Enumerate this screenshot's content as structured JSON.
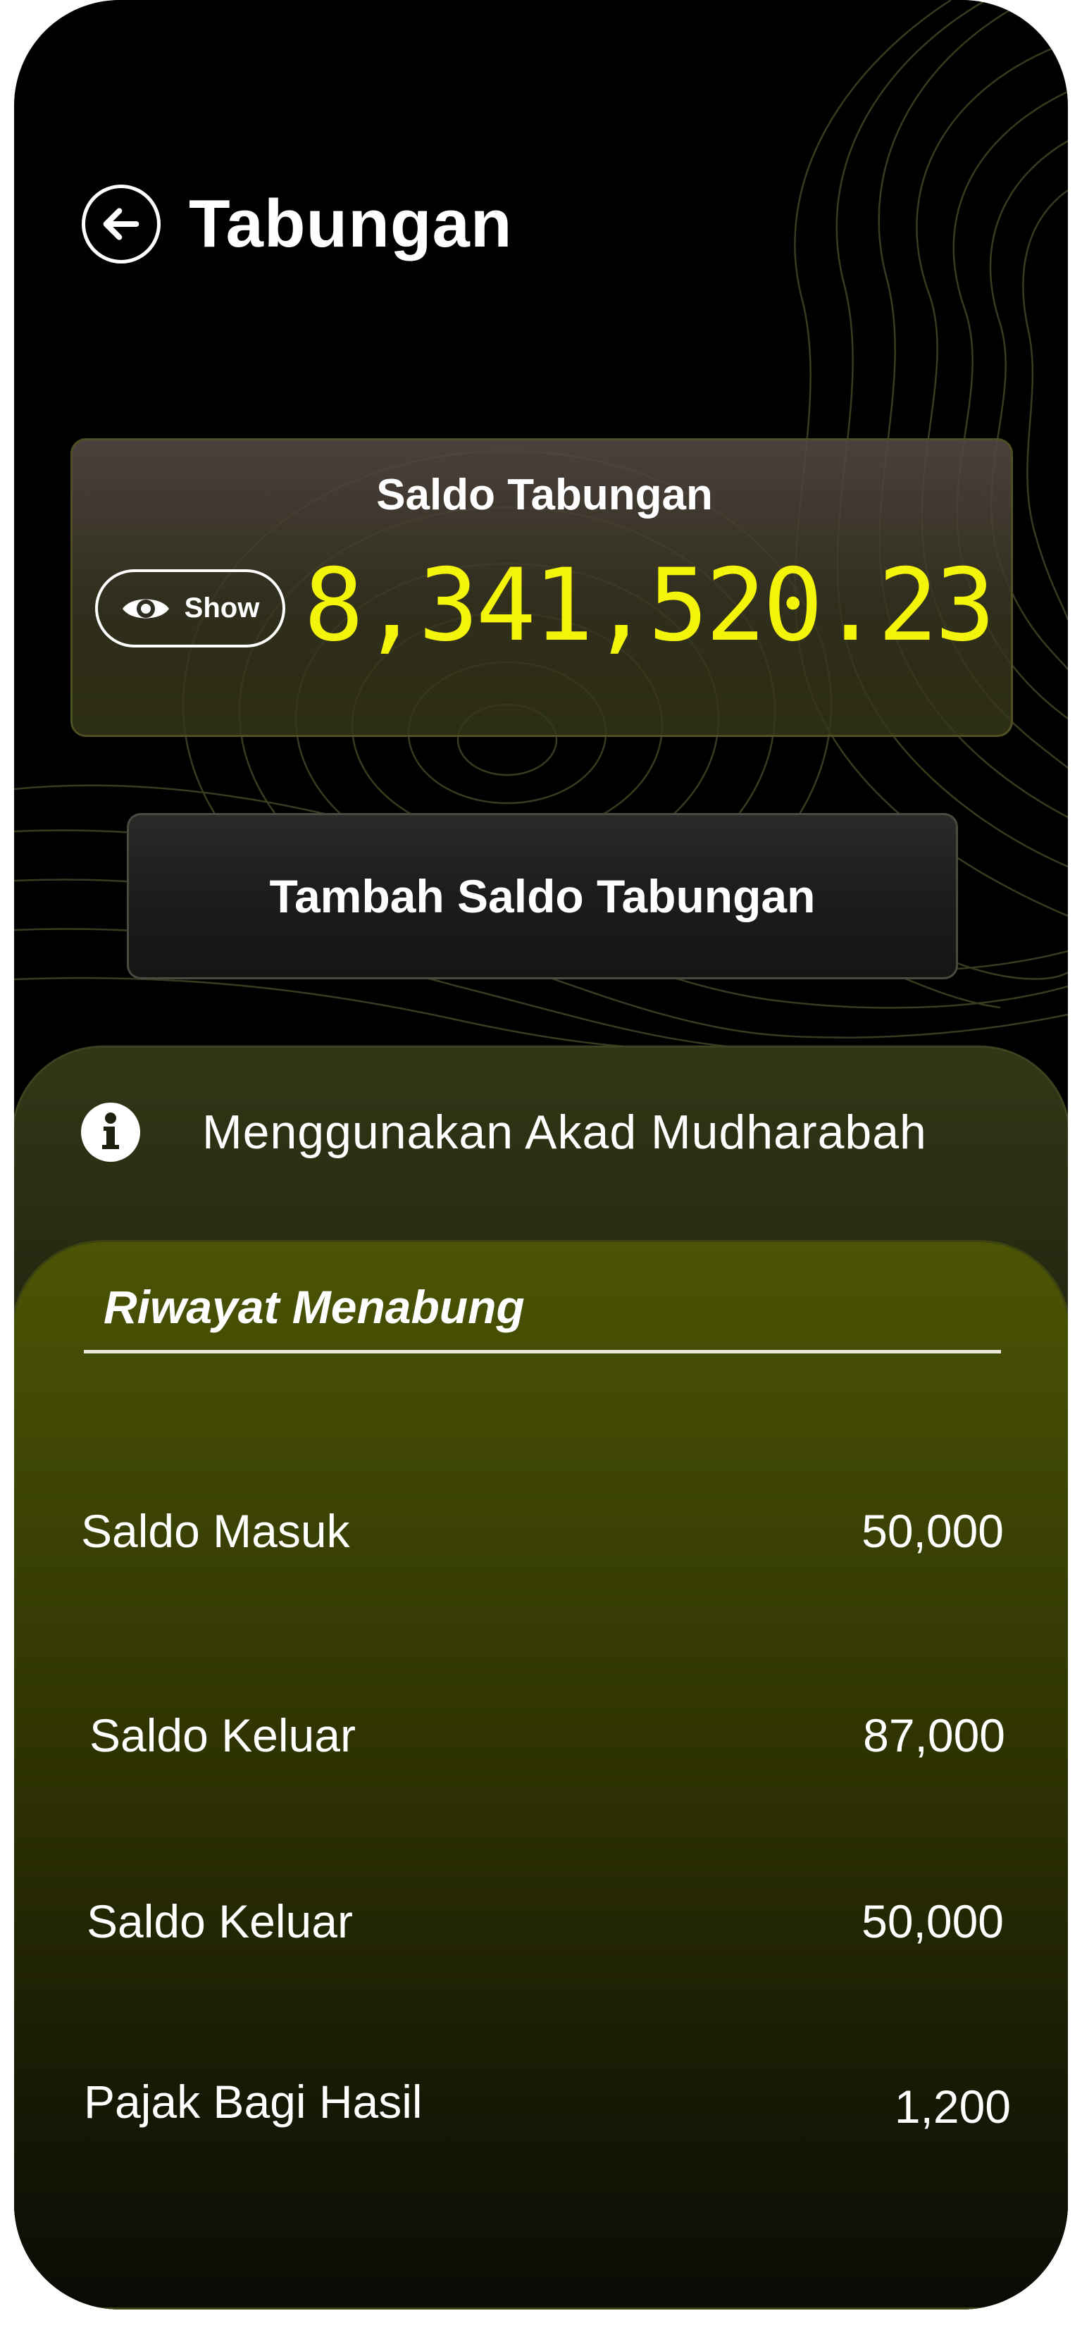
{
  "header": {
    "title": "Tabungan"
  },
  "balance_card": {
    "label": "Saldo Tabungan",
    "show_label": "Show",
    "amount": "8,341,520.23"
  },
  "actions": {
    "topup_label": "Tambah Saldo Tabungan"
  },
  "info": {
    "text": "Menggunakan Akad Mudharabah"
  },
  "history": {
    "title": "Riwayat Menabung",
    "items": [
      {
        "label": "Saldo Masuk",
        "amount": "50,000"
      },
      {
        "label": "Saldo Keluar",
        "amount": "87,000"
      },
      {
        "label": "Saldo Keluar",
        "amount": "50,000"
      },
      {
        "label": "Pajak Bagi Hasil",
        "amount": "1,200"
      }
    ]
  },
  "colors": {
    "background": "#000000",
    "accent_yellow": "#f4f40a",
    "panel_olive": "#4b5405",
    "text": "#ffffff"
  },
  "icons": {
    "back": "arrow-left-icon",
    "show": "eye-icon",
    "info": "info-icon"
  }
}
